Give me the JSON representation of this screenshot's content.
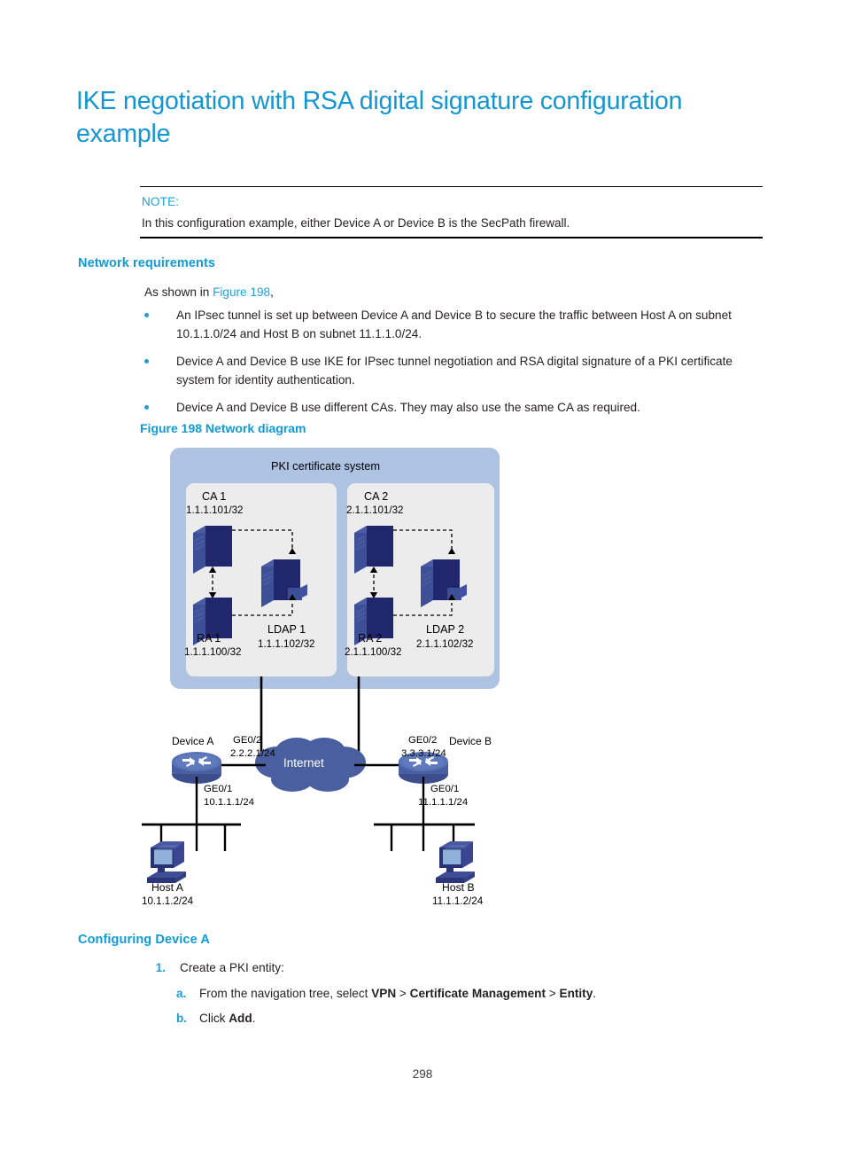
{
  "page": {
    "title": "IKE negotiation with RSA digital signature configuration example",
    "page_number": "298"
  },
  "note": {
    "label": "NOTE:",
    "text": "In this configuration example, either Device A or Device B is the SecPath firewall."
  },
  "sections": {
    "network_requirements_heading": "Network requirements",
    "configuring_device_a_heading": "Configuring Device A"
  },
  "intro": {
    "prefix": "As shown in ",
    "xref": "Figure 198",
    "suffix": ","
  },
  "bullets": [
    "An IPsec tunnel is set up between Device A and Device B to secure the traffic between Host A on subnet 10.1.1.0/24 and Host B on subnet 11.1.1.0/24.",
    "Device A and Device B use IKE for IPsec tunnel negotiation and RSA digital signature of a PKI certificate system for identity authentication.",
    "Device A and Device B use different CAs. They may also use the same CA as required."
  ],
  "figure": {
    "caption": "Figure 198 Network diagram",
    "pki_system_title": "PKI certificate system",
    "group1": {
      "ca_name": "CA 1",
      "ca_ip": "1.1.1.101/32",
      "ra_name": "RA 1",
      "ra_ip": "1.1.1.100/32",
      "ldap_name": "LDAP 1",
      "ldap_ip": "1.1.1.102/32"
    },
    "group2": {
      "ca_name": "CA 2",
      "ca_ip": "2.1.1.101/32",
      "ra_name": "RA 2",
      "ra_ip": "2.1.1.100/32",
      "ldap_name": "LDAP 2",
      "ldap_ip": "2.1.1.102/32"
    },
    "device_a": {
      "name": "Device A",
      "wan_if": "GE0/2",
      "wan_ip": "2.2.2.1/24",
      "lan_if": "GE0/1",
      "lan_ip": "10.1.1.1/24"
    },
    "device_b": {
      "name": "Device B",
      "wan_if": "GE0/2",
      "wan_ip": "3.3.3.1/24",
      "lan_if": "GE0/1",
      "lan_ip": "11.1.1.1/24"
    },
    "cloud_label": "Internet",
    "host_a": {
      "name": "Host A",
      "ip": "10.1.1.2/24"
    },
    "host_b": {
      "name": "Host B",
      "ip": "11.1.1.2/24"
    }
  },
  "steps": [
    {
      "number": "1.",
      "text": "Create a PKI entity:"
    }
  ],
  "substeps": [
    {
      "letter": "a.",
      "prefix": "From the navigation tree, select ",
      "bold1": "VPN",
      "sep1": " > ",
      "bold2": "Certificate Management",
      "sep2": " > ",
      "bold3": "Entity",
      "suffix": "."
    },
    {
      "letter": "b.",
      "prefix": "Click ",
      "bold1": "Add",
      "suffix": "."
    }
  ],
  "colors": {
    "heading_blue": "#1496d2",
    "section_blue": "#0f9bd7",
    "link_blue": "#19a3dd",
    "pki_box_fill": "#aec2e2",
    "inner_panel_fill": "#ececec",
    "server_front": "#1f2a6e",
    "server_top": "#4a5fa8",
    "server_side": "#47589e",
    "cloud_fill": "#4a5fa0",
    "router_body": "#4f6bb0",
    "host_body": "#3c4a9e"
  }
}
